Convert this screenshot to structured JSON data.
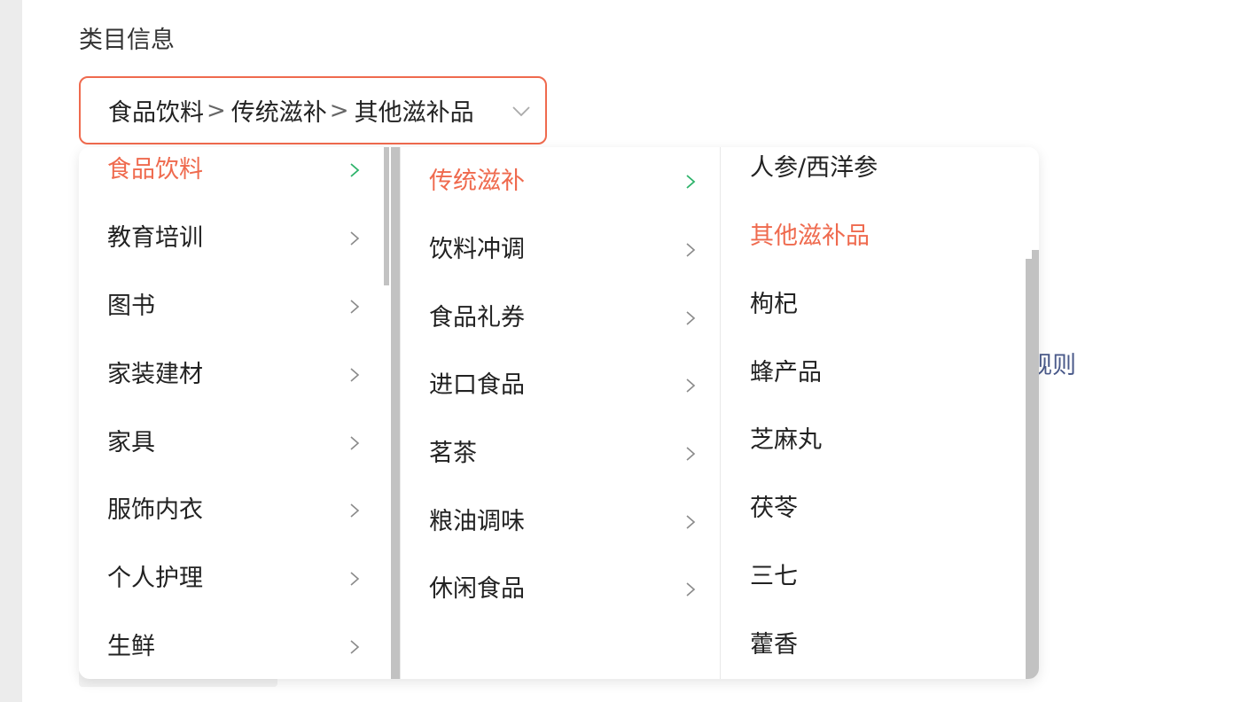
{
  "section": {
    "title": "类目信息"
  },
  "selector": {
    "crumbs": [
      "食品饮料",
      "传统滋补",
      "其他滋补品"
    ],
    "separator": ">"
  },
  "background": {
    "partial_link": "规则"
  },
  "cascader": {
    "level1": [
      {
        "label": "食品饮料",
        "active": true
      },
      {
        "label": "教育培训"
      },
      {
        "label": "图书"
      },
      {
        "label": "家装建材"
      },
      {
        "label": "家具"
      },
      {
        "label": "服饰内衣"
      },
      {
        "label": "个人护理"
      },
      {
        "label": "生鲜"
      }
    ],
    "level2": [
      {
        "label": "传统滋补",
        "active": true
      },
      {
        "label": "饮料冲调"
      },
      {
        "label": "食品礼券"
      },
      {
        "label": "进口食品"
      },
      {
        "label": "茗茶"
      },
      {
        "label": "粮油调味"
      },
      {
        "label": "休闲食品"
      }
    ],
    "level3": [
      {
        "label": "人参/西洋参"
      },
      {
        "label": "其他滋补品",
        "active": true
      },
      {
        "label": "枸杞"
      },
      {
        "label": "蜂产品"
      },
      {
        "label": "芝麻丸"
      },
      {
        "label": "茯苓"
      },
      {
        "label": "三七"
      },
      {
        "label": "藿香"
      }
    ]
  },
  "colors": {
    "accent": "#ef6a4e",
    "chevron_active": "#2db36a",
    "chevron": "#8a8a8a"
  },
  "icons": {
    "caret": "chevron-down-icon",
    "item_arrow": "chevron-right-icon"
  }
}
